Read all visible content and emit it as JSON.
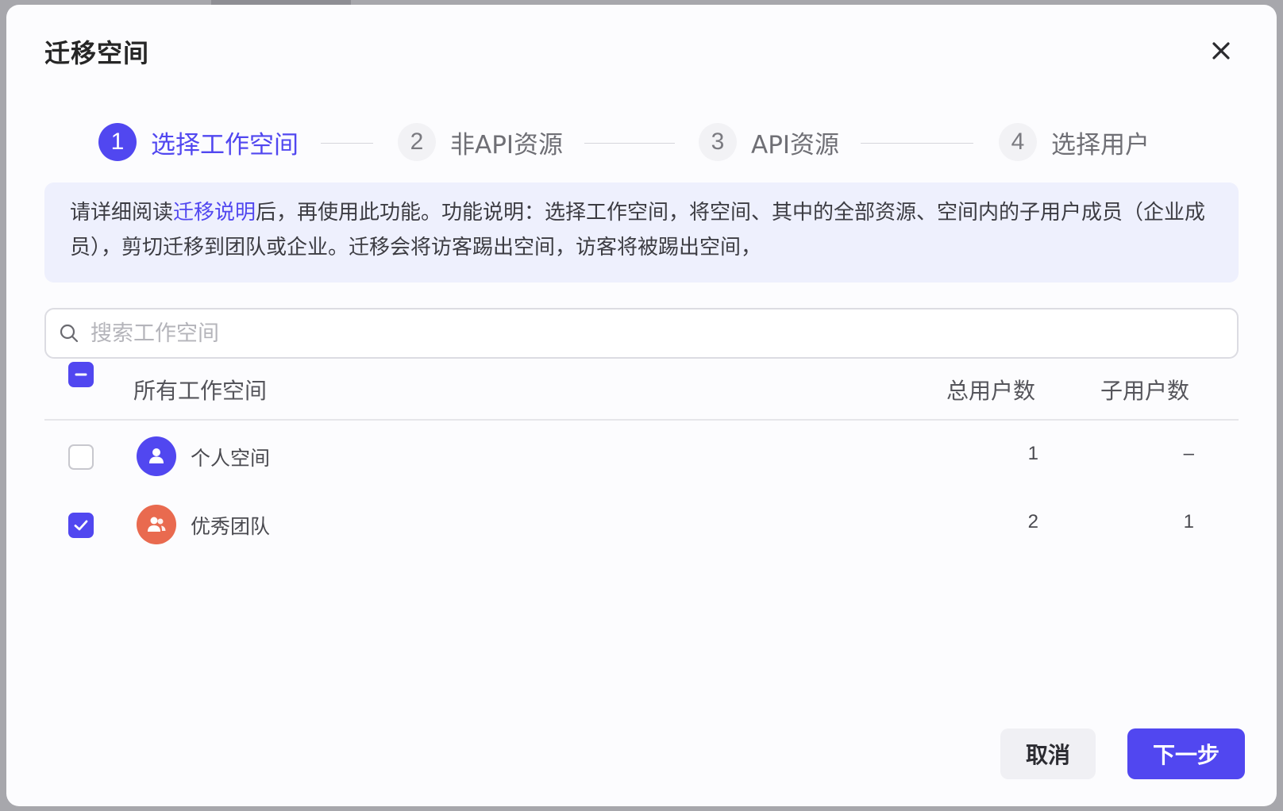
{
  "modal": {
    "title": "迁移空间"
  },
  "steps": [
    {
      "number": "1",
      "label": "选择工作空间",
      "active": true
    },
    {
      "number": "2",
      "label": "非API资源",
      "active": false
    },
    {
      "number": "3",
      "label": "API资源",
      "active": false
    },
    {
      "number": "4",
      "label": "选择用户",
      "active": false
    }
  ],
  "notice": {
    "prefix": "请详细阅读",
    "link": "迁移说明",
    "suffix": "后，再使用此功能。功能说明：选择工作空间，将空间、其中的全部资源、空间内的子用户成员（企业成员），剪切迁移到团队或企业。迁移会将访客踢出空间，访客将被踢出空间，"
  },
  "search": {
    "placeholder": "搜索工作空间",
    "value": ""
  },
  "table": {
    "headers": {
      "name": "所有工作空间",
      "total_users": "总用户数",
      "sub_users": "子用户数"
    },
    "select_all_state": "indeterminate",
    "rows": [
      {
        "name": "个人空间",
        "total_users": "1",
        "sub_users": "–",
        "checked": false,
        "avatar_icon": "user-icon",
        "avatar_color": "#5147f0"
      },
      {
        "name": "优秀团队",
        "total_users": "2",
        "sub_users": "1",
        "checked": true,
        "avatar_icon": "team-icon",
        "avatar_color": "#e96a4f"
      }
    ]
  },
  "footer": {
    "cancel_label": "取消",
    "next_label": "下一步"
  },
  "colors": {
    "accent": "#5147f0",
    "team_avatar": "#e96a4f"
  }
}
